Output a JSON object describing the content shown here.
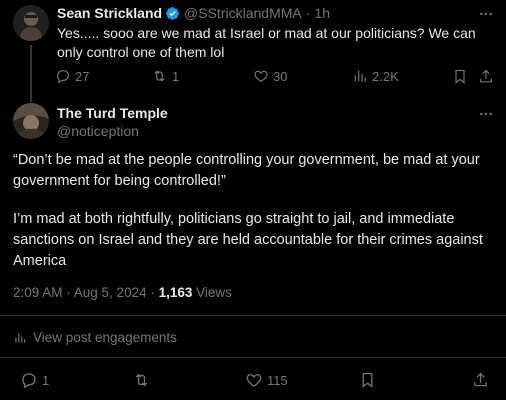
{
  "parent_tweet": {
    "author_name": "Sean Strickland",
    "handle": "@SStricklandMMA",
    "separator": "·",
    "time": "1h",
    "text": "Yes..... sooo are we mad at Israel or mad at our politicians? We can only control one of them lol",
    "replies": "27",
    "reposts": "1",
    "likes": "30",
    "views": "2.2K"
  },
  "main_tweet": {
    "author_name": "The Turd Temple",
    "handle": "@notiception",
    "paragraph_1": "“Don’t be mad at the people controlling your government, be mad at your government for being controlled!”",
    "paragraph_2": "I’m mad at both rightfully, politicians go straight to jail, and immediate sanctions on Israel and they are held accountable for their crimes against America",
    "timestamp": "2:09 AM · Aug 5, 2024 · ",
    "view_count": "1,163",
    "views_label": " Views",
    "engagements_label": "View post engagements",
    "replies": "1",
    "likes": "115"
  },
  "colors": {
    "background": "#000000",
    "text": "#e7e9ea",
    "muted": "#71767b",
    "verified": "#1d9bf0",
    "divider": "#2f3336"
  },
  "icons": [
    "more-icon",
    "verified-badge-icon",
    "reply-icon",
    "repost-icon",
    "like-icon",
    "views-icon",
    "bookmark-icon",
    "share-icon",
    "analytics-icon"
  ]
}
